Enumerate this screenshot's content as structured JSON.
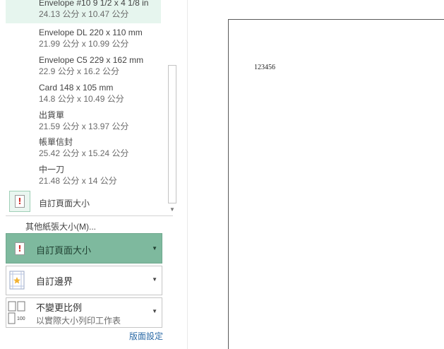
{
  "paper_sizes": {
    "items": [
      {
        "name": "Envelope #10 9 1/2 x 4 1/8 in",
        "dims": "24.13 公分 x 10.47 公分"
      },
      {
        "name": "Envelope DL 220 x 110 mm",
        "dims": "21.99 公分 x 10.99 公分"
      },
      {
        "name": "Envelope C5 229 x 162 mm",
        "dims": "22.9 公分 x 16.2 公分"
      },
      {
        "name": "Card 148 x 105 mm",
        "dims": "14.8 公分 x 10.49 公分"
      },
      {
        "name": "出貨單",
        "dims": "21.59 公分 x 13.97 公分"
      },
      {
        "name": "帳單信封",
        "dims": "25.42 公分 x 15.24 公分"
      },
      {
        "name": "中一刀",
        "dims": "21.48 公分 x 14 公分"
      }
    ],
    "custom_label": "自訂頁面大小",
    "more_sizes_label": "其他紙張大小(M)..."
  },
  "settings": {
    "paper_size": {
      "title": "自訂頁面大小"
    },
    "margins": {
      "title": "自訂邊界"
    },
    "scaling": {
      "title": "不變更比例",
      "subtitle": "以實際大小列印工作表",
      "icon_number": "100"
    },
    "page_setup_link": "版面設定"
  },
  "preview": {
    "text": "123456"
  },
  "colors": {
    "selected_bg": "#7eb99e",
    "hover_bg": "#e6f5ee",
    "link": "#2b6aa6",
    "warning_red": "#d0312d"
  }
}
